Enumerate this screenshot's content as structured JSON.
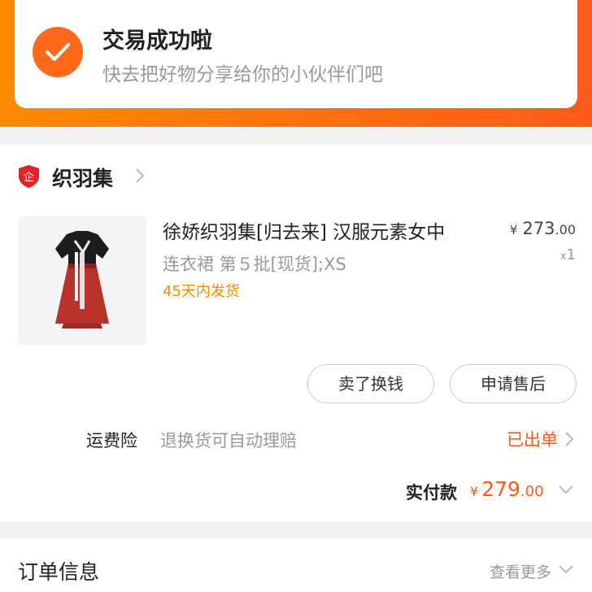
{
  "status": {
    "title": "交易成功啦",
    "subtitle": "快去把好物分享给你的小伙伴们吧"
  },
  "shop": {
    "badge_label": "企",
    "name": "织羽集"
  },
  "product": {
    "title": "徐娇织羽集[归去来] 汉服元素女中",
    "spec": "连衣裙 第５批[现货];XS",
    "delivery": "45天内发货",
    "price_currency": "¥",
    "price_int": "273",
    "price_cents": ".00",
    "qty_prefix": "x",
    "qty": "1"
  },
  "actions": {
    "sell_label": "卖了换钱",
    "aftersale_label": "申请售后"
  },
  "insurance": {
    "label": "运费险",
    "description": "退换货可自动理赔",
    "status": "已出单"
  },
  "payment": {
    "label": "实付款",
    "currency": "¥",
    "amount_int": "279",
    "amount_cents": ".00"
  },
  "order_info": {
    "title": "订单信息",
    "more_label": "查看更多"
  },
  "colors": {
    "brand_orange": "#ff6a1a",
    "price_orange": "#ff5a1a",
    "delivery_orange": "#ff8a00"
  },
  "icons": {
    "status": "check-icon",
    "shop": "enterprise-shield-icon",
    "chevron": "chevron-right-icon",
    "expand": "chevron-down-icon"
  }
}
